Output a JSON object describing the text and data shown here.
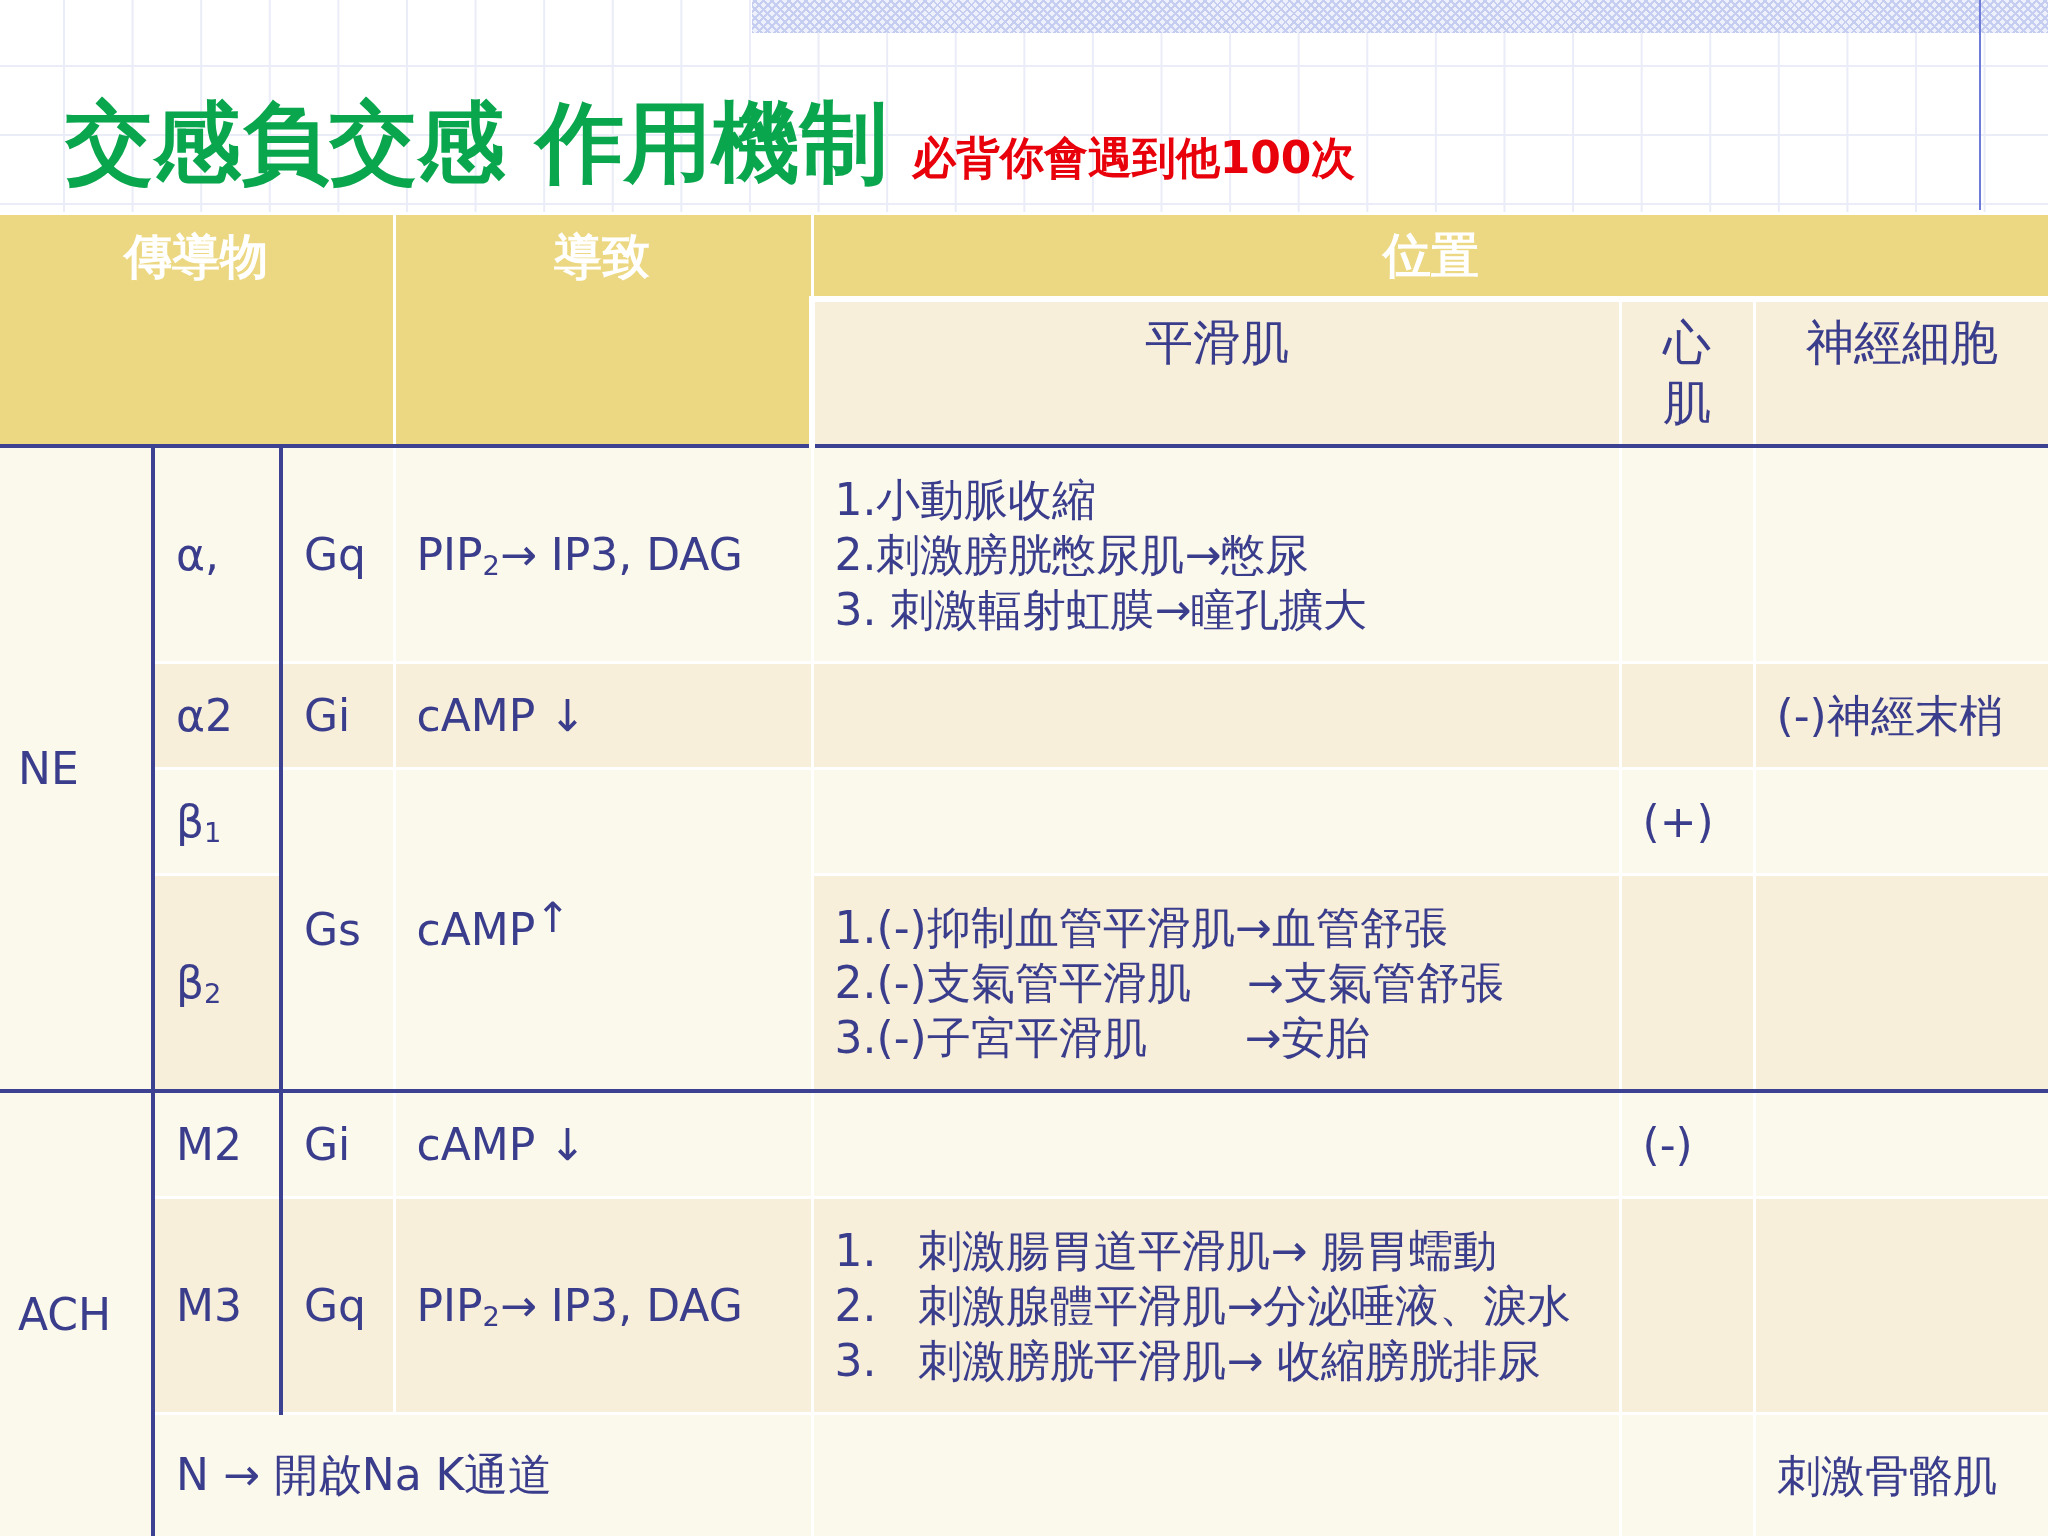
{
  "slide": {
    "title": "交感負交感 作用機制",
    "subtitle": "必背你會遇到他100次"
  },
  "table": {
    "header": {
      "transmitter": "傳導物",
      "effect": "導致",
      "location": {
        "label": "位置",
        "subcolumns": [
          "平滑肌",
          "心肌",
          "神經細胞"
        ]
      }
    },
    "groups": [
      {
        "transmitter": "NE",
        "rows": [
          {
            "kind": "receptor",
            "receptor": "α,",
            "g_protein": "Gq",
            "effect": "PIP$_{2}$→ IP3, DAG",
            "smooth_muscle": [
              "1.小動脈收縮",
              "2.刺激膀胱憋尿肌→憋尿",
              "3. 刺激輻射虹膜→瞳孔擴大"
            ]
          },
          {
            "kind": "receptor",
            "receptor": "α2",
            "g_protein": "Gi",
            "effect": "cAMP ↓",
            "neuron": "(-)神經末梢"
          },
          {
            "kind": "receptor",
            "receptor": "β$_{1}$",
            "g_protein": "Gs",
            "effect": "cAMP$^{↑}$",
            "cardiac": "(+)"
          },
          {
            "kind": "receptor",
            "receptor": "β$_{2}$",
            "smooth_muscle": [
              "1.(-)抑制血管平滑肌→血管舒張",
              "2.(-)支氣管平滑肌    →支氣管舒張",
              "3.(-)子宮平滑肌       →安胎"
            ]
          }
        ]
      },
      {
        "transmitter": "ACH",
        "rows": [
          {
            "kind": "receptor",
            "receptor": "M2",
            "g_protein": "Gi",
            "effect": "cAMP ↓",
            "cardiac": "(-)"
          },
          {
            "kind": "receptor",
            "receptor": "M3",
            "g_protein": "Gq",
            "effect": "PIP$_{2}$→ IP3, DAG",
            "smooth_muscle": [
              "1.   刺激腸胃道平滑肌→ 腸胃蠕動",
              "2.   刺激腺體平滑肌→分泌唾液、淚水",
              "3.   刺激膀胱平滑肌→ 收縮膀胱排尿"
            ]
          },
          {
            "kind": "channel",
            "receptor": "N → 開啟Na K通道",
            "neuron": "刺激骨骼肌"
          }
        ]
      }
    ]
  }
}
